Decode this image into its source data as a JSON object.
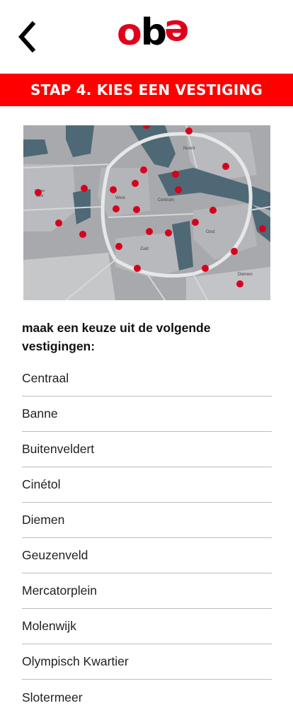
{
  "header": {
    "back_icon": "chevron-left-icon",
    "logo_text": "oba",
    "colors": {
      "brand_red": "#e0001a",
      "banner_red": "#ff0000"
    }
  },
  "step": {
    "title": "STAP 4. KIES EEN VESTIGING"
  },
  "map": {
    "labels": [
      "Noord",
      "Nieuw west",
      "West",
      "Centrum",
      "Oost",
      "Zuid",
      "Diemen"
    ],
    "markers": [
      "1",
      "2",
      "3",
      "4",
      "5",
      "6",
      "7",
      "8",
      "9",
      "10",
      "11",
      "12",
      "13",
      "14",
      "15",
      "16",
      "17",
      "18",
      "19",
      "20",
      "21",
      "22",
      "23",
      "24"
    ]
  },
  "instruction": "maak een keuze uit de volgende vestigingen:",
  "locations": [
    "Centraal",
    "Banne",
    "Buitenveldert",
    "Cinétol",
    "Diemen",
    "Geuzenveld",
    "Mercatorplein",
    "Molenwijk",
    "Olympisch Kwartier",
    "Slotermeer"
  ]
}
